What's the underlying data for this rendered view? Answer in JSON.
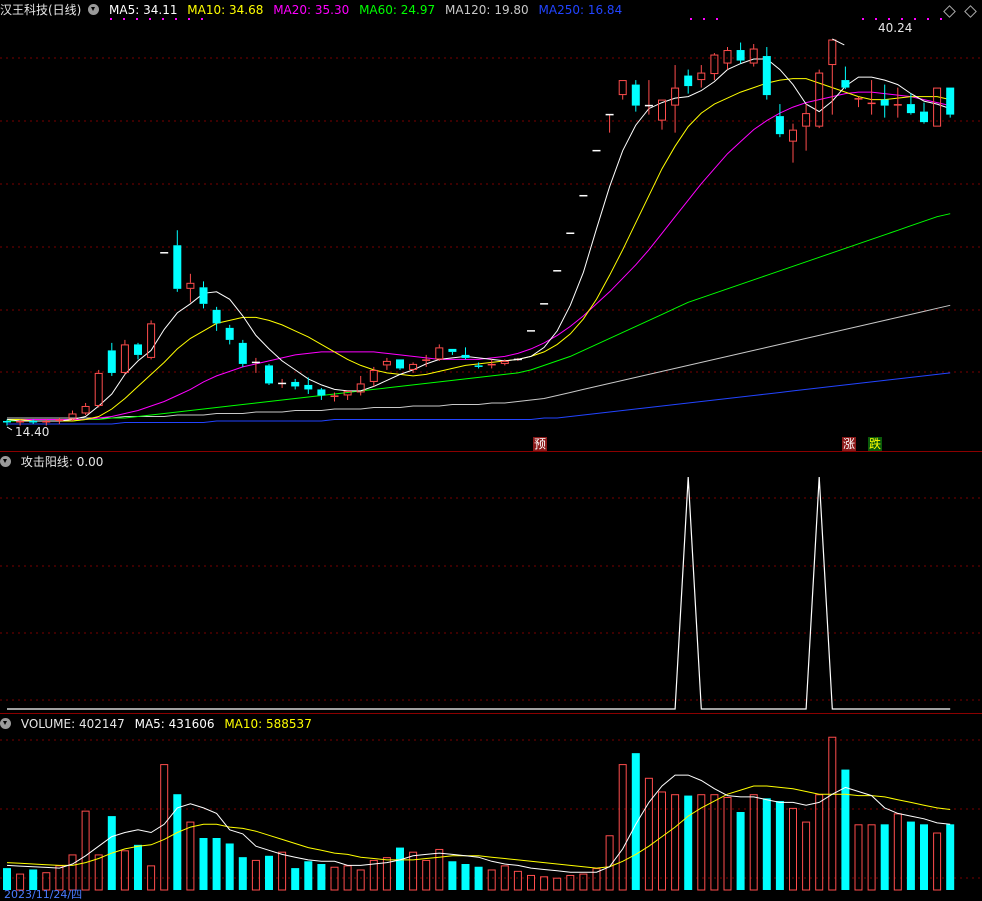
{
  "main": {
    "title": "汉王科技(日线)",
    "ma5_label": "MA5:",
    "ma5_value": "34.11",
    "ma10_label": "MA10:",
    "ma10_value": "34.68",
    "ma20_label": "MA20:",
    "ma20_value": "35.30",
    "ma60_label": "MA60:",
    "ma60_value": "24.97",
    "ma120_label": "MA120:",
    "ma120_value": "19.80",
    "ma250_label": "MA250:",
    "ma250_value": "16.84",
    "high_label": "40.24",
    "low_label": "14.40",
    "signal_yu": "预",
    "signal_zhang": "涨",
    "signal_die": "跌"
  },
  "indicator": {
    "title": "攻击阳线",
    "value": ": 0.00"
  },
  "volume": {
    "label": "VOLUME:",
    "value": "402147",
    "ma5_label": "MA5:",
    "ma5_value": "431606",
    "ma10_label": "MA10:",
    "ma10_value": "588537"
  },
  "footer": {
    "date": "2023/11/24/四"
  },
  "colors": {
    "up": "#ff4d4d",
    "down": "#00ffff",
    "ma5": "#ffffff",
    "ma10": "#ffff00",
    "ma20": "#ff00ff",
    "ma60": "#00ff00",
    "ma120": "#c8c8c8",
    "ma250": "#2244ff"
  },
  "chart_data": [
    {
      "type": "candlestick",
      "candles": [
        [
          14.8,
          14.9,
          14.5,
          14.7
        ],
        [
          14.7,
          14.9,
          14.5,
          14.8
        ],
        [
          14.8,
          14.9,
          14.6,
          14.7
        ],
        [
          14.7,
          14.9,
          14.5,
          14.8
        ],
        [
          14.8,
          15.0,
          14.6,
          14.9
        ],
        [
          14.9,
          15.5,
          14.8,
          15.3
        ],
        [
          15.3,
          16.0,
          15.2,
          15.8
        ],
        [
          15.8,
          18.2,
          15.7,
          18.0
        ],
        [
          19.5,
          20.0,
          17.8,
          18.0
        ],
        [
          18.0,
          20.2,
          17.9,
          19.9
        ],
        [
          19.9,
          20.0,
          18.9,
          19.2
        ],
        [
          19.0,
          21.5,
          18.9,
          21.3
        ],
        [
          26.0,
          26.0,
          26.0,
          26.0
        ],
        [
          26.5,
          27.5,
          23.4,
          23.6
        ],
        [
          23.6,
          24.6,
          22.7,
          24.0
        ],
        [
          23.7,
          24.1,
          22.3,
          22.6
        ],
        [
          22.2,
          22.4,
          20.8,
          21.3
        ],
        [
          21.0,
          21.2,
          19.9,
          20.2
        ],
        [
          20.0,
          20.2,
          18.4,
          18.6
        ],
        [
          18.7,
          19.0,
          18.0,
          18.7
        ],
        [
          18.5,
          18.6,
          17.2,
          17.3
        ],
        [
          17.3,
          17.6,
          17.0,
          17.3
        ],
        [
          17.4,
          17.6,
          16.9,
          17.1
        ],
        [
          17.2,
          17.7,
          16.6,
          16.9
        ],
        [
          16.9,
          17.0,
          16.2,
          16.5
        ],
        [
          16.4,
          16.7,
          16.1,
          16.5
        ],
        [
          16.5,
          16.8,
          16.2,
          16.8
        ],
        [
          16.7,
          17.8,
          16.5,
          17.3
        ],
        [
          17.4,
          18.4,
          17.1,
          18.2
        ],
        [
          18.5,
          19.0,
          18.2,
          18.8
        ],
        [
          18.9,
          18.9,
          18.2,
          18.3
        ],
        [
          18.2,
          18.7,
          18.0,
          18.6
        ],
        [
          18.8,
          19.2,
          18.4,
          18.9
        ],
        [
          18.9,
          19.9,
          18.8,
          19.7
        ],
        [
          19.6,
          19.6,
          19.2,
          19.4
        ],
        [
          19.2,
          19.7,
          18.9,
          19.0
        ],
        [
          18.5,
          18.7,
          18.3,
          18.4
        ],
        [
          18.5,
          18.9,
          18.3,
          18.6
        ],
        [
          18.6,
          18.9,
          18.5,
          18.8
        ],
        [
          18.9,
          19.0,
          18.8,
          18.9
        ],
        [
          20.8,
          20.8,
          20.8,
          20.8
        ],
        [
          22.6,
          22.6,
          22.6,
          22.6
        ],
        [
          24.8,
          24.8,
          24.8,
          24.8
        ],
        [
          27.3,
          27.3,
          27.3,
          27.3
        ],
        [
          29.8,
          29.8,
          29.8,
          29.8
        ],
        [
          32.8,
          32.8,
          32.8,
          32.8
        ],
        [
          35.2,
          35.2,
          34.0,
          35.2
        ],
        [
          36.5,
          37.5,
          36.2,
          37.5
        ],
        [
          37.2,
          37.5,
          35.4,
          35.8
        ],
        [
          35.8,
          37.5,
          35.2,
          35.8
        ],
        [
          34.8,
          36.2,
          34.2,
          36.2
        ],
        [
          35.8,
          38.5,
          34.0,
          37.0
        ],
        [
          37.8,
          38.2,
          36.6,
          37.1
        ],
        [
          37.5,
          38.5,
          37.0,
          38.0
        ],
        [
          37.9,
          39.3,
          37.5,
          39.2
        ],
        [
          38.6,
          39.7,
          38.2,
          39.5
        ],
        [
          39.5,
          40.0,
          38.6,
          38.8
        ],
        [
          38.6,
          39.9,
          38.4,
          39.6
        ],
        [
          39.1,
          39.7,
          36.2,
          36.5
        ],
        [
          35.1,
          35.9,
          33.7,
          33.9
        ],
        [
          33.4,
          34.6,
          32.0,
          34.2
        ],
        [
          34.4,
          35.9,
          32.8,
          35.3
        ],
        [
          34.4,
          38.2,
          34.3,
          38.0
        ],
        [
          38.5,
          40.2,
          35.2,
          40.2
        ],
        [
          37.5,
          38.4,
          36.9,
          37.0
        ],
        [
          36.2,
          36.4,
          35.7,
          36.3
        ],
        [
          35.9,
          37.5,
          35.2,
          36.0
        ],
        [
          36.2,
          37.2,
          35.0,
          35.8
        ],
        [
          35.8,
          37.0,
          35.0,
          35.9
        ],
        [
          35.9,
          36.6,
          35.2,
          35.3
        ],
        [
          35.4,
          36.0,
          34.6,
          34.7
        ],
        [
          34.4,
          37.0,
          34.4,
          37.0
        ],
        [
          37.0,
          37.0,
          35.0,
          35.2
        ]
      ],
      "ma5": [
        14.9,
        14.8,
        14.8,
        14.8,
        14.8,
        14.9,
        15.1,
        15.8,
        16.6,
        17.9,
        18.8,
        19.5,
        20.9,
        22.0,
        22.6,
        23.3,
        23.4,
        22.9,
        21.8,
        20.5,
        19.6,
        18.8,
        18.2,
        17.6,
        17.2,
        16.9,
        16.8,
        16.8,
        17.1,
        17.5,
        17.9,
        18.2,
        18.6,
        18.9,
        19.0,
        19.1,
        19.0,
        18.9,
        18.8,
        18.9,
        19.1,
        19.7,
        20.8,
        22.5,
        24.7,
        27.6,
        30.4,
        32.8,
        34.5,
        35.6,
        36.0,
        36.3,
        36.4,
        36.8,
        37.4,
        38.2,
        38.6,
        38.9,
        38.9,
        38.2,
        37.2,
        35.9,
        35.4,
        36.1,
        37.1,
        37.7,
        37.7,
        37.5,
        37.2,
        36.6,
        36.1,
        35.9,
        35.6
      ],
      "ma10": [
        14.9,
        14.9,
        14.8,
        14.8,
        14.8,
        14.8,
        14.9,
        15.1,
        15.6,
        16.3,
        17.1,
        17.9,
        18.7,
        19.6,
        20.3,
        20.8,
        21.3,
        21.5,
        21.7,
        21.7,
        21.5,
        21.2,
        20.8,
        20.4,
        19.9,
        19.4,
        18.9,
        18.5,
        18.2,
        18.0,
        17.9,
        17.8,
        17.9,
        18.1,
        18.3,
        18.5,
        18.6,
        18.7,
        18.8,
        18.9,
        19.1,
        19.4,
        19.9,
        20.6,
        21.6,
        22.9,
        24.5,
        26.2,
        28.0,
        29.8,
        31.6,
        33.1,
        34.4,
        35.3,
        35.9,
        36.3,
        36.7,
        37.0,
        37.3,
        37.5,
        37.6,
        37.6,
        37.3,
        37.0,
        36.7,
        36.4,
        36.2,
        36.2,
        36.3,
        36.4,
        36.4,
        36.4,
        36.2
      ],
      "ma20": [
        14.9,
        14.9,
        14.9,
        14.9,
        14.9,
        14.9,
        14.9,
        15.0,
        15.1,
        15.3,
        15.5,
        15.8,
        16.1,
        16.5,
        16.9,
        17.4,
        17.8,
        18.1,
        18.4,
        18.6,
        18.8,
        19.0,
        19.2,
        19.3,
        19.4,
        19.4,
        19.4,
        19.4,
        19.4,
        19.3,
        19.2,
        19.1,
        19.0,
        18.9,
        18.9,
        18.9,
        18.9,
        19.0,
        19.1,
        19.3,
        19.6,
        20.0,
        20.5,
        21.1,
        21.8,
        22.6,
        23.4,
        24.3,
        25.2,
        26.2,
        27.3,
        28.4,
        29.5,
        30.6,
        31.6,
        32.6,
        33.4,
        34.2,
        34.8,
        35.3,
        35.7,
        36.0,
        36.2,
        36.4,
        36.6,
        36.7,
        36.7,
        36.6,
        36.5,
        36.4,
        36.2,
        36.0,
        35.8
      ],
      "ma60": [
        14.8,
        14.8,
        14.8,
        14.8,
        14.8,
        14.8,
        14.9,
        14.9,
        15.0,
        15.0,
        15.1,
        15.2,
        15.3,
        15.4,
        15.5,
        15.6,
        15.7,
        15.8,
        15.9,
        16.0,
        16.1,
        16.2,
        16.3,
        16.4,
        16.5,
        16.6,
        16.7,
        16.8,
        16.9,
        17.0,
        17.1,
        17.2,
        17.3,
        17.4,
        17.5,
        17.6,
        17.7,
        17.8,
        17.9,
        18.0,
        18.2,
        18.5,
        18.8,
        19.1,
        19.5,
        19.9,
        20.3,
        20.7,
        21.1,
        21.5,
        21.9,
        22.3,
        22.7,
        23.0,
        23.3,
        23.6,
        23.9,
        24.2,
        24.5,
        24.8,
        25.1,
        25.4,
        25.7,
        26.0,
        26.3,
        26.6,
        26.9,
        27.2,
        27.5,
        27.8,
        28.1,
        28.4,
        28.6
      ],
      "ma120": [
        15.0,
        15.0,
        15.0,
        15.0,
        15.0,
        15.0,
        15.0,
        15.0,
        15.0,
        15.1,
        15.1,
        15.1,
        15.1,
        15.2,
        15.2,
        15.2,
        15.3,
        15.3,
        15.3,
        15.4,
        15.4,
        15.4,
        15.5,
        15.5,
        15.5,
        15.6,
        15.6,
        15.6,
        15.7,
        15.7,
        15.7,
        15.8,
        15.8,
        15.8,
        15.9,
        15.9,
        15.9,
        16.0,
        16.0,
        16.1,
        16.2,
        16.3,
        16.5,
        16.7,
        16.9,
        17.1,
        17.3,
        17.5,
        17.7,
        17.9,
        18.1,
        18.3,
        18.5,
        18.7,
        18.9,
        19.1,
        19.3,
        19.5,
        19.7,
        19.9,
        20.1,
        20.3,
        20.5,
        20.7,
        20.9,
        21.1,
        21.3,
        21.5,
        21.7,
        21.9,
        22.1,
        22.3,
        22.5
      ],
      "ma250": [
        14.6,
        14.6,
        14.6,
        14.6,
        14.6,
        14.6,
        14.6,
        14.6,
        14.6,
        14.7,
        14.7,
        14.7,
        14.7,
        14.7,
        14.7,
        14.7,
        14.8,
        14.8,
        14.8,
        14.8,
        14.8,
        14.8,
        14.8,
        14.8,
        14.8,
        14.9,
        14.9,
        14.9,
        14.9,
        14.9,
        14.9,
        14.9,
        14.9,
        14.9,
        14.9,
        14.9,
        14.9,
        14.9,
        14.9,
        14.9,
        14.9,
        15.0,
        15.0,
        15.1,
        15.2,
        15.3,
        15.4,
        15.5,
        15.6,
        15.7,
        15.8,
        15.9,
        16.0,
        16.1,
        16.2,
        16.3,
        16.4,
        16.5,
        16.6,
        16.7,
        16.8,
        16.9,
        17.0,
        17.1,
        17.2,
        17.3,
        17.4,
        17.5,
        17.6,
        17.7,
        17.8,
        17.9,
        18.0
      ],
      "ylim": [
        14.0,
        41.5
      ]
    },
    {
      "type": "line",
      "name": "攻击阳线",
      "values": [
        0,
        0,
        0,
        0,
        0,
        0,
        0,
        0,
        0,
        0,
        0,
        0,
        0,
        0,
        0,
        0,
        0,
        0,
        0,
        0,
        0,
        0,
        0,
        0,
        0,
        0,
        0,
        0,
        0,
        0,
        0,
        0,
        0,
        0,
        0,
        0,
        0,
        0,
        0,
        0,
        0,
        0,
        0,
        0,
        0,
        0,
        0,
        0,
        0,
        0,
        0,
        0,
        1,
        0,
        0,
        0,
        0,
        0,
        0,
        0,
        0,
        0,
        1,
        0,
        0,
        0,
        0,
        0,
        0,
        0,
        0,
        0,
        0
      ],
      "ylim": [
        0,
        1.03
      ]
    },
    {
      "type": "bar",
      "name": "VOLUME",
      "values": [
        160,
        120,
        150,
        130,
        180,
        260,
        580,
        260,
        540,
        290,
        330,
        180,
        920,
        700,
        500,
        380,
        380,
        340,
        240,
        220,
        250,
        280,
        160,
        210,
        190,
        170,
        180,
        150,
        220,
        240,
        310,
        280,
        220,
        300,
        210,
        190,
        170,
        150,
        180,
        140,
        110,
        100,
        90,
        110,
        120,
        160,
        400,
        920,
        1000,
        820,
        720,
        700,
        690,
        700,
        700,
        680,
        570,
        700,
        670,
        650,
        600,
        500,
        700,
        1120,
        880,
        480,
        480,
        480,
        560,
        500,
        480,
        420,
        480
      ],
      "ma5": [
        180,
        175,
        170,
        165,
        160,
        190,
        250,
        320,
        390,
        420,
        440,
        420,
        480,
        600,
        630,
        600,
        560,
        440,
        410,
        320,
        290,
        260,
        240,
        220,
        210,
        210,
        180,
        180,
        190,
        200,
        220,
        250,
        260,
        270,
        260,
        250,
        240,
        210,
        190,
        180,
        160,
        150,
        140,
        130,
        130,
        130,
        170,
        300,
        480,
        640,
        760,
        840,
        840,
        800,
        740,
        690,
        680,
        680,
        660,
        640,
        640,
        620,
        640,
        700,
        750,
        720,
        690,
        600,
        560,
        540,
        520,
        490,
        480
      ],
      "ma10": [
        200,
        195,
        190,
        185,
        180,
        180,
        200,
        230,
        270,
        300,
        320,
        330,
        370,
        420,
        460,
        480,
        480,
        460,
        450,
        430,
        400,
        370,
        340,
        310,
        290,
        270,
        260,
        240,
        230,
        220,
        220,
        220,
        230,
        240,
        250,
        250,
        250,
        240,
        230,
        220,
        210,
        200,
        190,
        180,
        170,
        160,
        170,
        210,
        260,
        320,
        390,
        460,
        540,
        600,
        650,
        700,
        730,
        760,
        760,
        750,
        740,
        720,
        700,
        700,
        700,
        690,
        690,
        680,
        660,
        640,
        620,
        600,
        588
      ]
    }
  ]
}
